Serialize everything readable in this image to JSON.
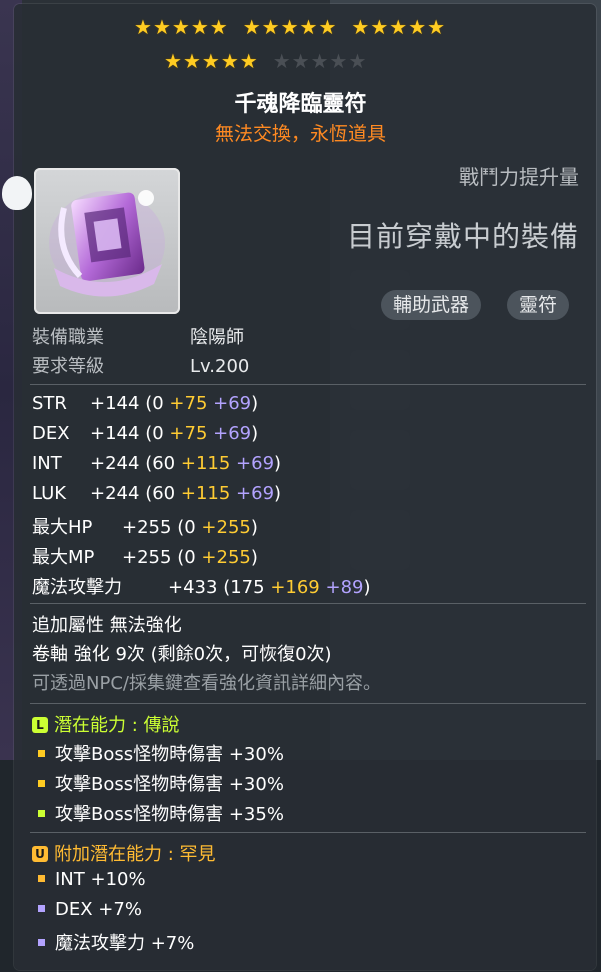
{
  "stars": {
    "filled": 20,
    "total": 25
  },
  "item": {
    "name": "千魂降臨靈符",
    "trade_note": "無法交換，永恆道具",
    "power_label": "戰鬥力提升量",
    "equipped_text": "目前穿戴中的裝備",
    "tags": [
      "輔助武器",
      "靈符"
    ],
    "icon": "talisman-icon"
  },
  "requirements": {
    "job_label": "裝備職業",
    "job_value": "陰陽師",
    "level_label": "要求等級",
    "level_value": "Lv.200"
  },
  "stats": [
    {
      "name": "STR",
      "total": "+144",
      "base": "(0",
      "bonus": "+75",
      "extra": "+69",
      "close": ")"
    },
    {
      "name": "DEX",
      "total": "+144",
      "base": "(0",
      "bonus": "+75",
      "extra": "+69",
      "close": ")"
    },
    {
      "name": "INT",
      "total": "+244",
      "base": "(60",
      "bonus": "+115",
      "extra": "+69",
      "close": ")"
    },
    {
      "name": "LUK",
      "total": "+244",
      "base": "(60",
      "bonus": "+115",
      "extra": "+69",
      "close": ")"
    },
    {
      "name": "最大HP",
      "total": "+255",
      "base": "(0",
      "bonus": "+255",
      "extra": "",
      "close": ")"
    },
    {
      "name": "最大MP",
      "total": "+255",
      "base": "(0",
      "bonus": "+255",
      "extra": "",
      "close": ")"
    },
    {
      "name": "魔法攻擊力",
      "total": "+433",
      "base": "(175",
      "bonus": "+169",
      "extra": "+89",
      "close": ")"
    }
  ],
  "enhance": {
    "extra_attr": "追加屬性 無法強化",
    "scroll": "卷軸 強化 9次 (剩餘0次，可恢復0次)",
    "hint": "可透過NPC/採集鍵查看強化資訊詳細內容。"
  },
  "potential": {
    "badge": "L",
    "title": "潛在能力 : 傳說",
    "lines": [
      "攻擊Boss怪物時傷害 +30%",
      "攻擊Boss怪物時傷害 +30%",
      "攻擊Boss怪物時傷害 +35%"
    ]
  },
  "additional": {
    "badge": "U",
    "title": "附加潛在能力 : 罕見",
    "lines": [
      "INT +10%",
      "DEX +7%",
      "魔法攻擊力 +7%"
    ]
  },
  "colors": {
    "legendary": "#ccff33",
    "unique": "#ffbb33",
    "star": "#ffcc22",
    "bonus": "#ffcc33",
    "extra": "#b3a3ff"
  }
}
